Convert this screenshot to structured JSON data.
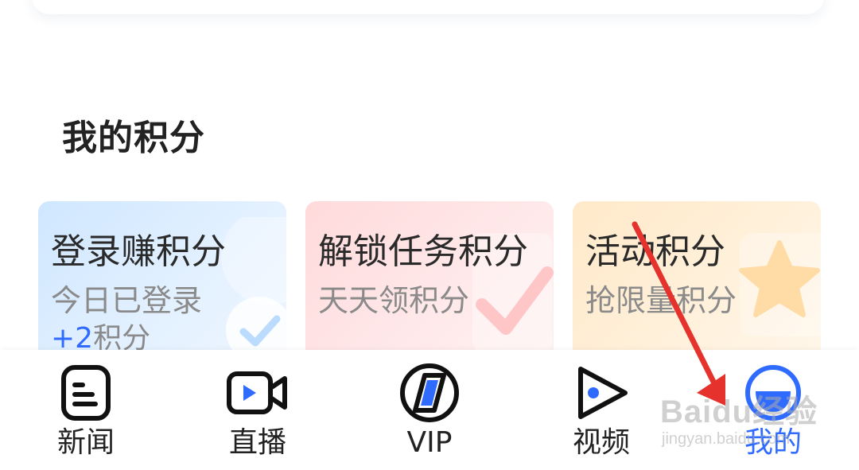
{
  "section": {
    "title": "我的积分"
  },
  "cards": [
    {
      "title": "登录赚积分",
      "subtitle": "今日已登录",
      "points_plus": "+2",
      "points_unit": "积分"
    },
    {
      "title": "解锁任务积分",
      "subtitle": "天天领积分"
    },
    {
      "title": "活动积分",
      "subtitle": "抢限量积分"
    }
  ],
  "bottom_nav": {
    "items": [
      {
        "label": "新闻",
        "icon": "news-icon",
        "active": false
      },
      {
        "label": "直播",
        "icon": "live-camera-icon",
        "active": false
      },
      {
        "label": "VIP",
        "icon": "vip-icon",
        "active": false
      },
      {
        "label": "视频",
        "icon": "video-play-icon",
        "active": false
      },
      {
        "label": "我的",
        "icon": "profile-icon",
        "active": true
      }
    ]
  },
  "watermark": {
    "main": "Baidu经验",
    "sub": "jingyan.baidu.com"
  },
  "colors": {
    "accent": "#2f6bff",
    "annotation_arrow": "#e5322d",
    "card_blue": "#d8ecff",
    "card_pink": "#ffe0e1",
    "card_orange": "#ffecd2"
  }
}
